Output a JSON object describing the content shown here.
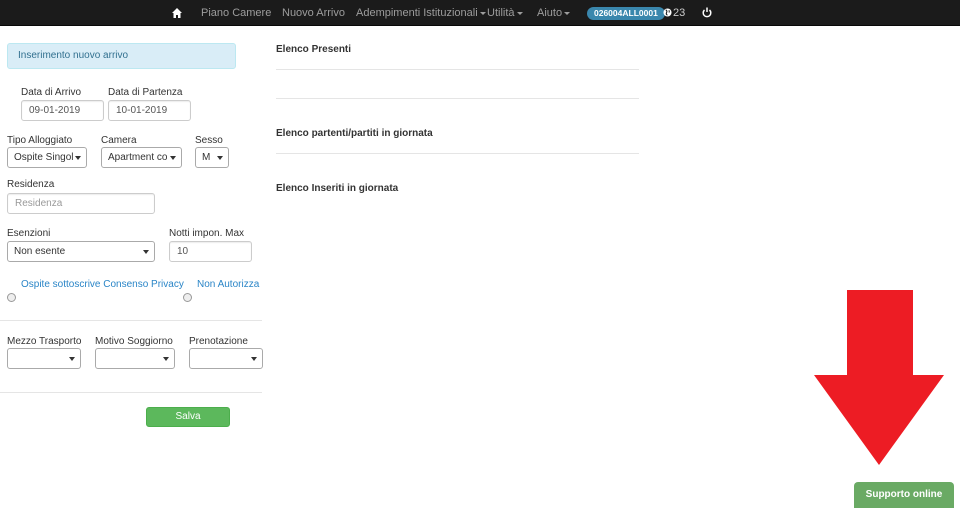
{
  "navbar": {
    "home_icon": "home-icon",
    "items": [
      {
        "label": "Piano Camere"
      },
      {
        "label": "Nuovo Arrivo"
      },
      {
        "label": "Adempimenti Istituzionali"
      },
      {
        "label": "Utilità"
      },
      {
        "label": "Aiuto"
      }
    ],
    "badge": "026004ALL0001",
    "online_count": "23",
    "power_icon": "power-icon"
  },
  "form": {
    "alert": "Inserimento nuovo arrivo",
    "arrival_label": "Data di Arrivo",
    "arrival_value": "09-01-2019",
    "departure_label": "Data di Partenza",
    "departure_value": "10-01-2019",
    "lodging_label": "Tipo Alloggiato",
    "lodging_value": "Ospite Singol",
    "room_label": "Camera",
    "room_value": "Apartment co",
    "sex_label": "Sesso",
    "sex_value": "M",
    "residence_label": "Residenza",
    "residence_placeholder": "Residenza",
    "exemptions_label": "Esenzioni",
    "exemptions_value": "Non esente",
    "nights_label": "Notti impon. Max",
    "nights_value": "10",
    "privacy_consent": "Ospite sottoscrive Consenso Privacy",
    "privacy_deny": "Non Autorizza",
    "transport_label": "Mezzo Trasporto",
    "transport_value": "",
    "reason_label": "Motivo Soggiorno",
    "reason_value": "",
    "booking_label": "Prenotazione",
    "booking_value": "",
    "save": "Salva"
  },
  "lists": {
    "present": "Elenco Presenti",
    "departures": "Elenco partenti/partiti in giornata",
    "inserted": "Elenco Inseriti in giornata"
  },
  "support": "Supporto online",
  "colors": {
    "navbar": "#1b1b1b",
    "badge": "#3a87ad",
    "save": "#5cb85c",
    "support": "#6aaa64",
    "arrow": "#ed1c24"
  }
}
